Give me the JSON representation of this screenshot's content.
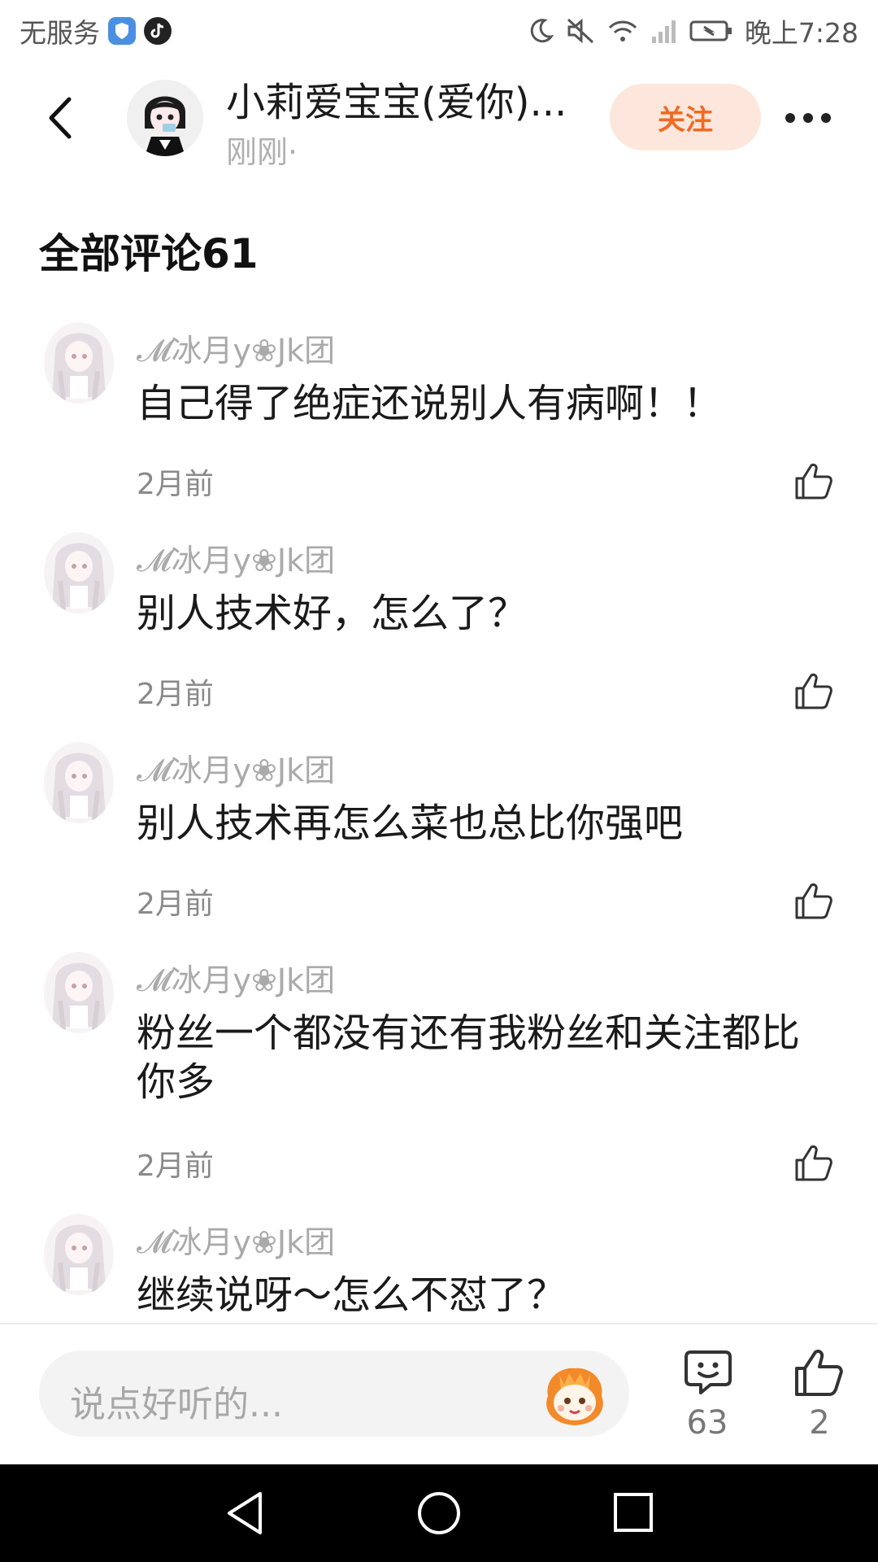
{
  "status_bar": {
    "carrier": "无服务",
    "time": "晚上7:28"
  },
  "header": {
    "author_name": "小莉爱宝宝(爱你)...",
    "post_time": "刚刚·",
    "follow_label": "关注"
  },
  "comments_section": {
    "title": "全部评论61",
    "items": [
      {
        "user": "𝓜冰月y❀Jk团",
        "text": "自己得了绝症还说别人有病啊！！",
        "time": "2月前"
      },
      {
        "user": "𝓜冰月y❀Jk团",
        "text": " 别人技术好，怎么了？",
        "time": "2月前"
      },
      {
        "user": "𝓜冰月y❀Jk团",
        "text": "别人技术再怎么菜也总比你强吧",
        "time": "2月前"
      },
      {
        "user": "𝓜冰月y❀Jk团",
        "text": "粉丝一个都没有还有我粉丝和关注都比你多",
        "time": "2月前"
      },
      {
        "user": "𝓜冰月y❀Jk团",
        "text": "继续说呀～怎么不怼了？",
        "time": ""
      }
    ]
  },
  "bottom_bar": {
    "input_placeholder": "说点好听的...",
    "comments_count": "63",
    "likes_count": "2"
  },
  "icons": {
    "back": "chevron-left-icon",
    "more": "more-dots-icon",
    "like": "thumbs-up-icon",
    "comment": "comment-bubble-icon",
    "emoji": "mascot-emoji-icon"
  },
  "colors": {
    "accent": "#f06a25",
    "follow_bg": "#fde7dc"
  }
}
